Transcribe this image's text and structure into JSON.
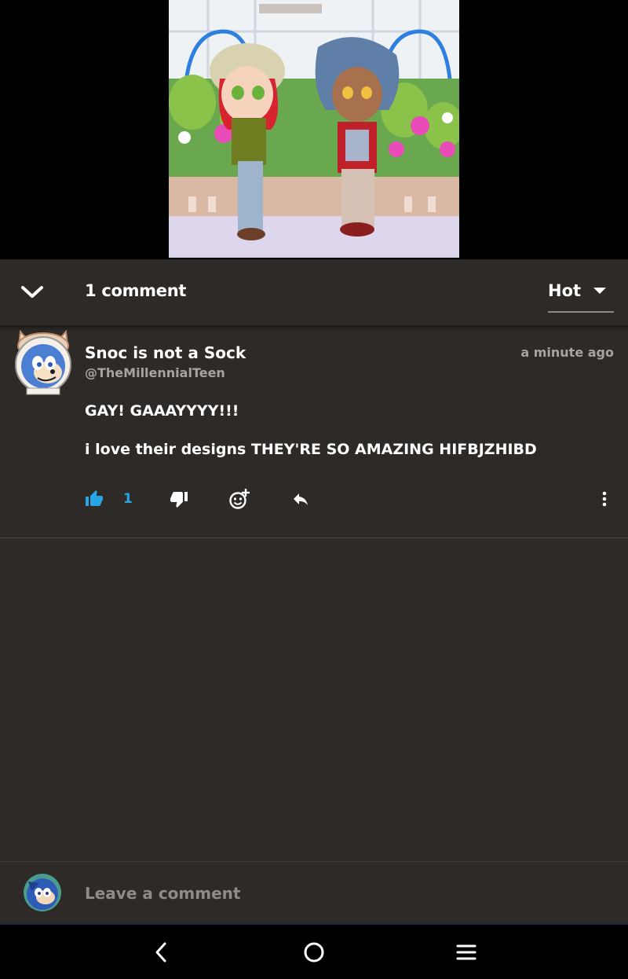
{
  "header": {
    "comment_count": "1 comment",
    "sort_selected": "Hot"
  },
  "comment": {
    "author_name": "Snoc is not a Sock",
    "author_handle": "@TheMillennialTeen",
    "timestamp": "a minute ago",
    "body_lines": [
      "GAY! GAAAYYYY!!!",
      "i love their designs THEY'RE SO AMAZING HIFBJZHIBD"
    ],
    "like_count": "1"
  },
  "compose": {
    "placeholder": "Leave a comment"
  },
  "icons": {
    "collapse": "chevron-down-icon",
    "sort": "caret-down-icon",
    "like": "thumbs-up-icon",
    "dislike": "thumbs-down-icon",
    "reaction": "add-emoji-icon",
    "reply": "reply-icon",
    "more": "more-vertical-icon",
    "nav_back": "back-icon",
    "nav_home": "home-icon",
    "nav_menu": "menu-icon"
  },
  "colors": {
    "accent": "#27a5e6",
    "background": "#2d2a27",
    "muted_text": "#a7a4a0"
  }
}
